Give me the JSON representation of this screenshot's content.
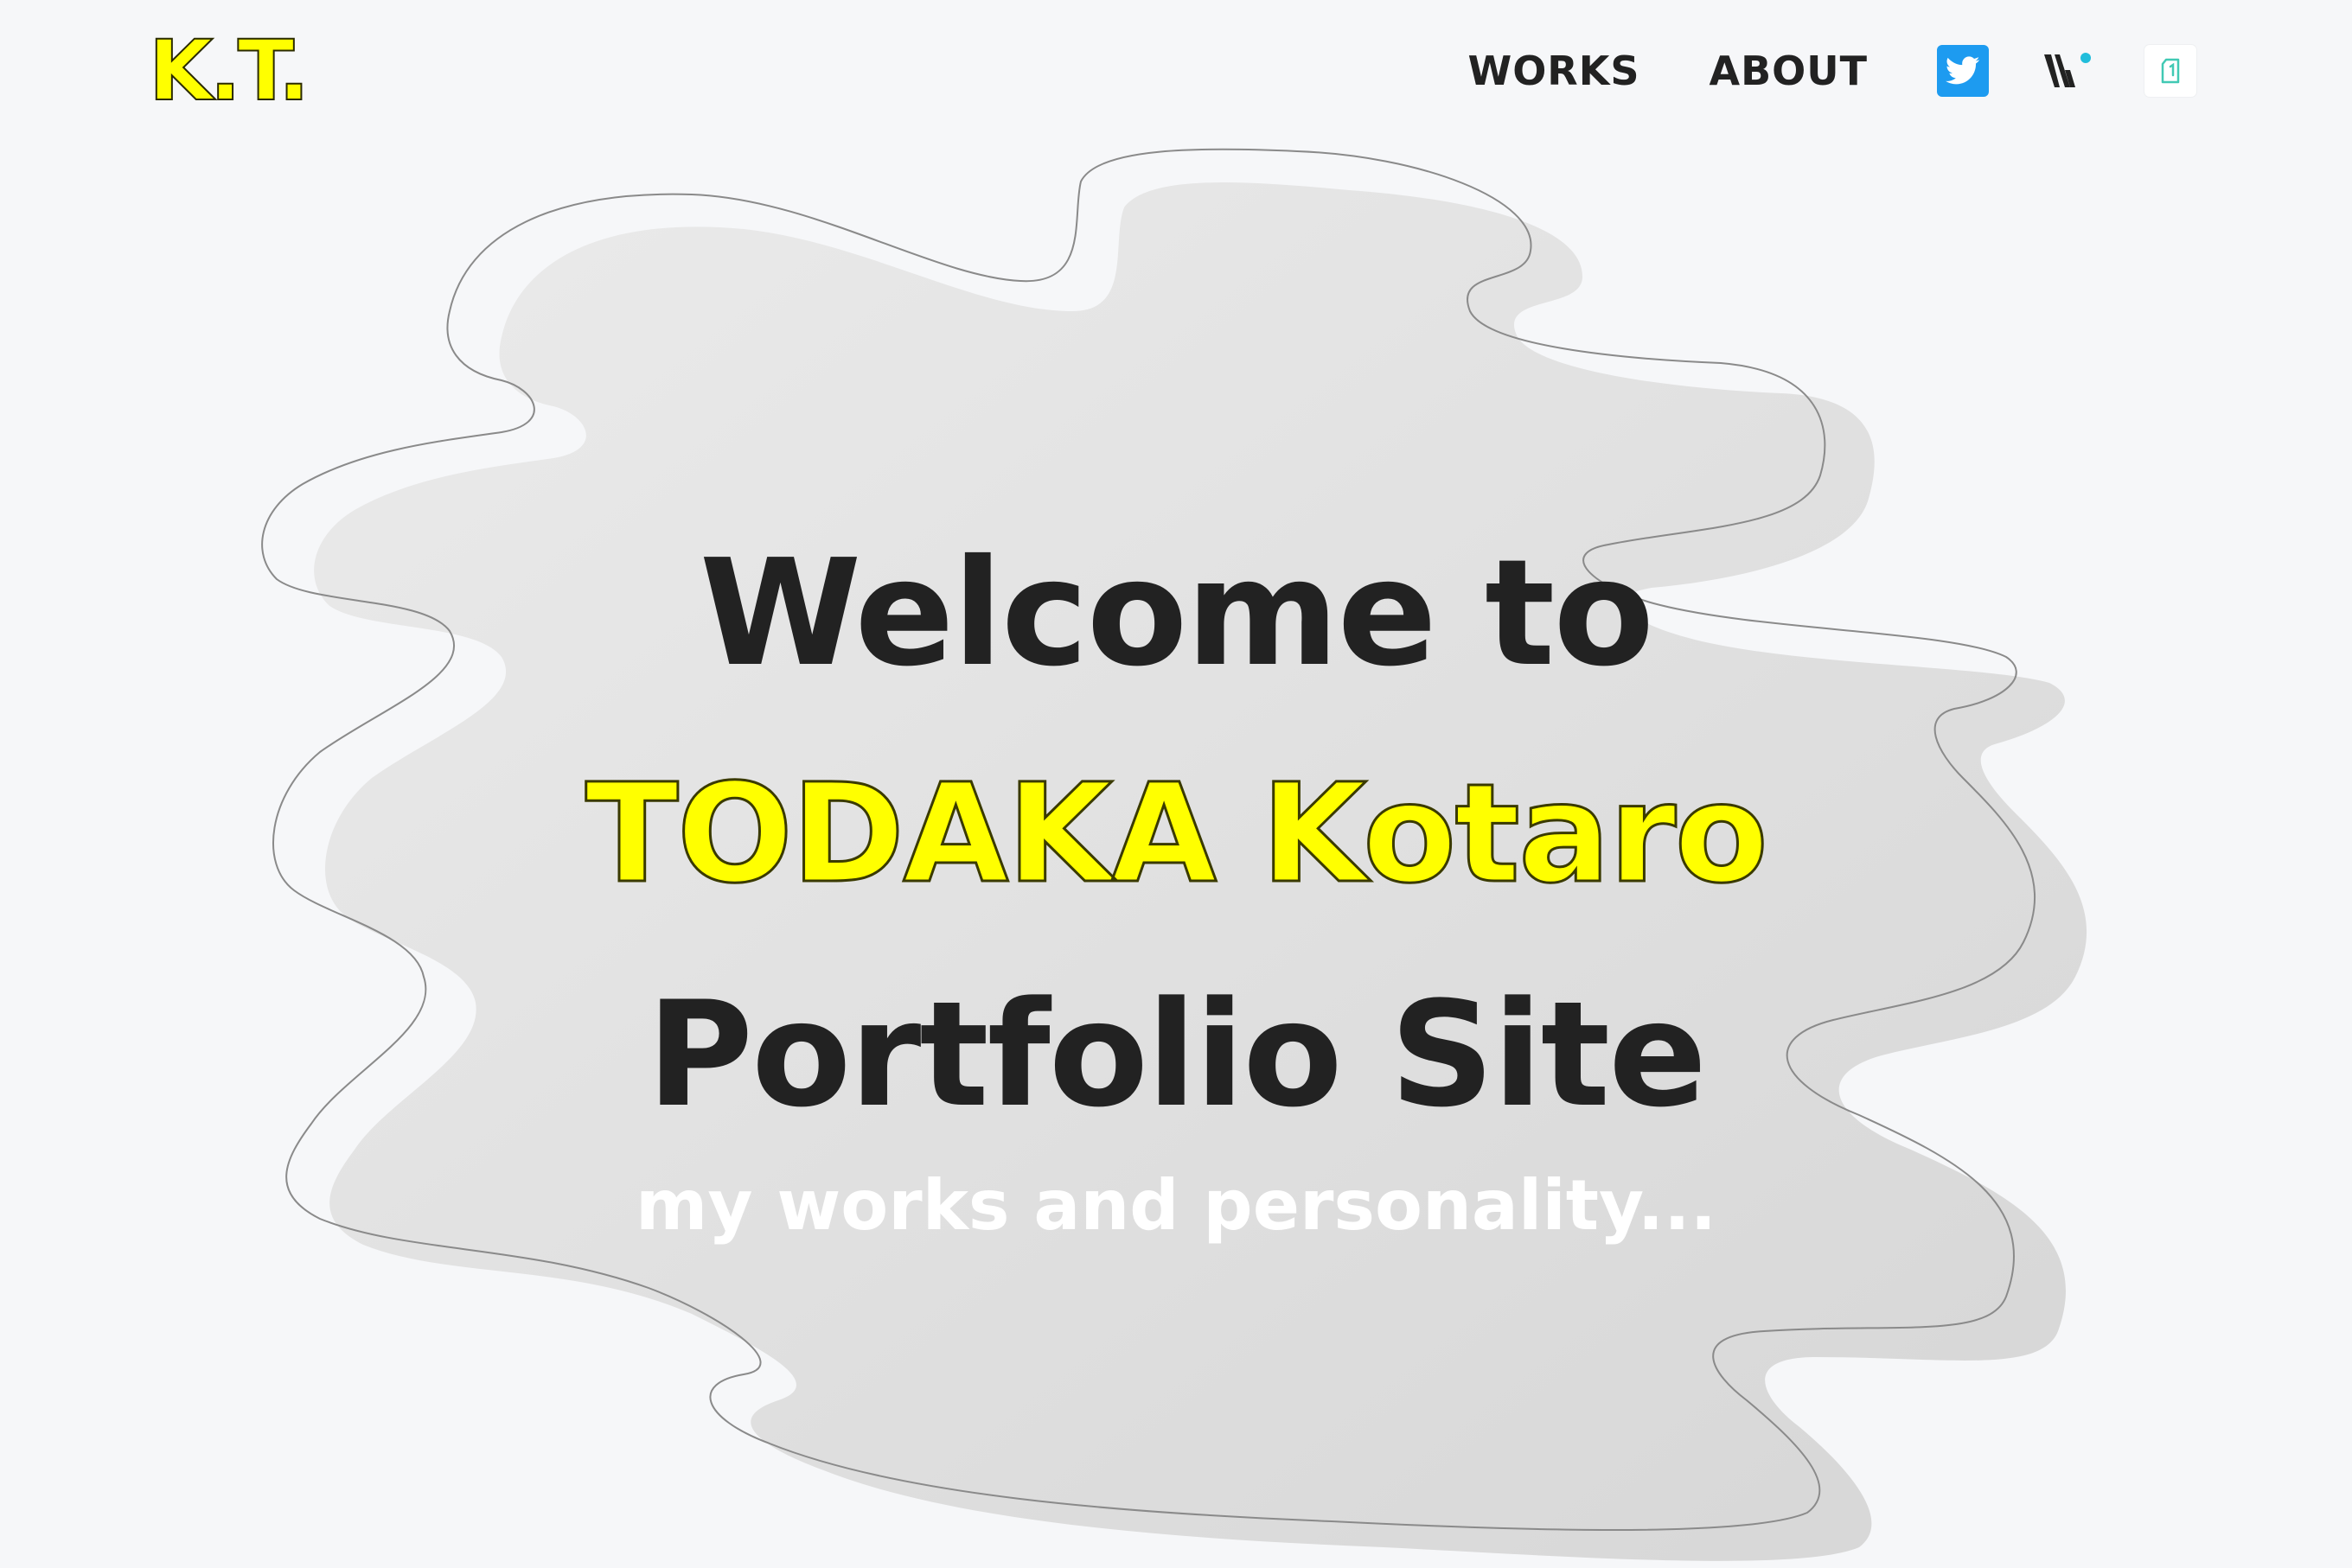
{
  "header": {
    "logo": "K.T.",
    "nav": [
      {
        "label": "WORKS"
      },
      {
        "label": "ABOUT"
      }
    ],
    "social": [
      {
        "name": "twitter-icon"
      },
      {
        "name": "wantedly-icon"
      },
      {
        "name": "note-icon"
      }
    ]
  },
  "hero": {
    "line1": "Welcome to",
    "line2": "TODAKA Kotaro",
    "line3": "Portfolio Site",
    "tagline": "my works and personality..."
  },
  "colors": {
    "background": "#f6f7f9",
    "accent_yellow": "#ffff00",
    "text_dark": "#222222",
    "twitter_blue": "#1d9bf0",
    "wantedly_dot": "#21bddb",
    "note_green": "#41c9b4"
  }
}
